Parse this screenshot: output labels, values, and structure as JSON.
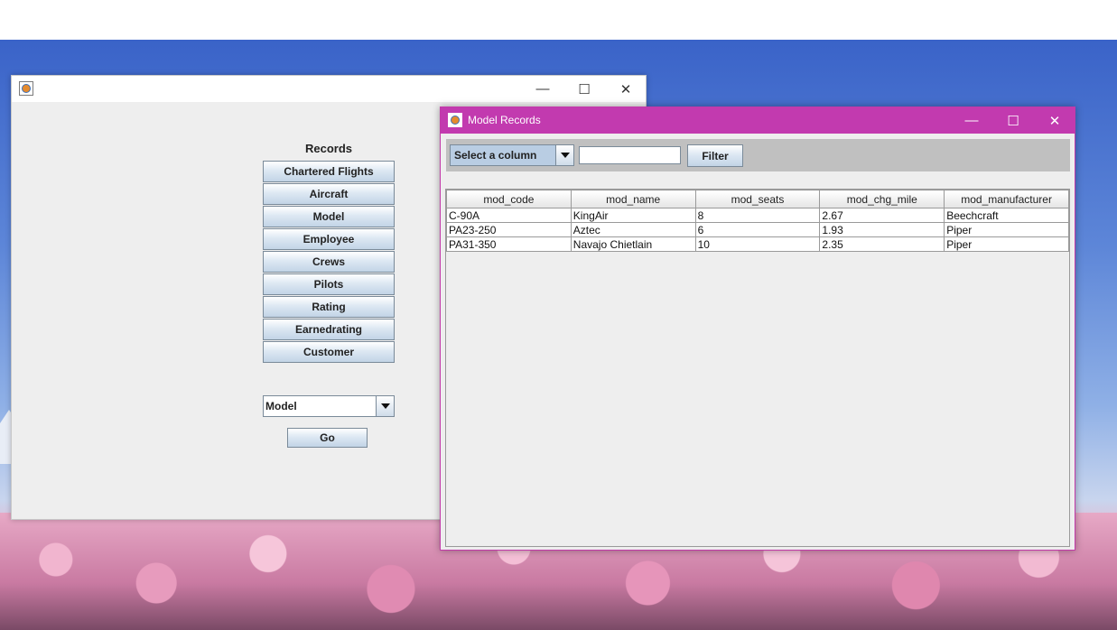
{
  "main_window": {
    "records_heading": "Records",
    "buttons": [
      "Chartered Flights",
      "Aircraft",
      "Model",
      "Employee",
      "Crews",
      "Pilots",
      "Rating",
      "Earnedrating",
      "Customer"
    ],
    "table_select_value": "Model",
    "go_label": "Go",
    "controls": {
      "minimize": "—",
      "maximize": "☐",
      "close": "✕"
    }
  },
  "model_window": {
    "title": "Model Records",
    "column_select_placeholder": "Select a column",
    "filter_value": "",
    "filter_label": "Filter",
    "controls": {
      "minimize": "—",
      "maximize": "☐",
      "close": "✕"
    },
    "table": {
      "headers": [
        "mod_code",
        "mod_name",
        "mod_seats",
        "mod_chg_mile",
        "mod_manufacturer"
      ],
      "rows": [
        [
          "C-90A",
          "KingAir",
          "8",
          "2.67",
          "Beechcraft"
        ],
        [
          "PA23-250",
          "Aztec",
          "6",
          "1.93",
          "Piper"
        ],
        [
          "PA31-350",
          "Navajo Chietlain",
          "10",
          "2.35",
          "Piper"
        ]
      ]
    }
  },
  "colors": {
    "model_titlebar": "#c23aaf",
    "window_bg": "#eeeeee"
  }
}
